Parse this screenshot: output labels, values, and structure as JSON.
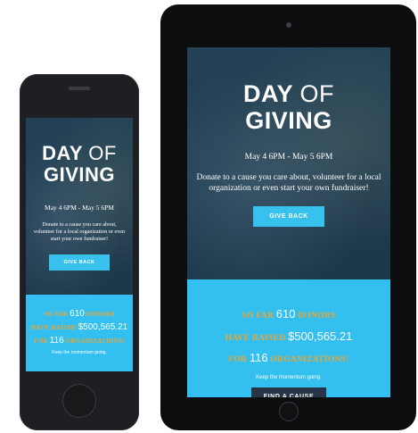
{
  "event": {
    "title_day": "DAY",
    "title_of": "OF",
    "title_giving": "GIVING",
    "dates": "May 4 6PM - May 5 6PM",
    "tagline": "Donate to a cause you care about, volunteer for a local organization or even start your own fundraiser!",
    "give_back_label": "GIVE BACK"
  },
  "stats": {
    "donors_prefix": "SO FAR",
    "donors_count": "610",
    "donors_label": "DONORS",
    "raised_prefix": "HAVE RAISED",
    "raised_amount": "$500,565.21",
    "orgs_prefix": "FOR",
    "orgs_count": "116",
    "orgs_label": "ORGANIZATIONS!",
    "momentum_text": "Keep the momentum going.",
    "find_cause_label": "FIND A CAUSE"
  },
  "colors": {
    "accent_blue": "#33bff0",
    "stat_orange": "#f2a32a",
    "dark_button": "#263548",
    "device_frame": "#1d1f22"
  },
  "icons": {
    "phone_home": "home-button-icon",
    "tablet_home": "home-button-icon",
    "tablet_camera": "camera-icon"
  }
}
